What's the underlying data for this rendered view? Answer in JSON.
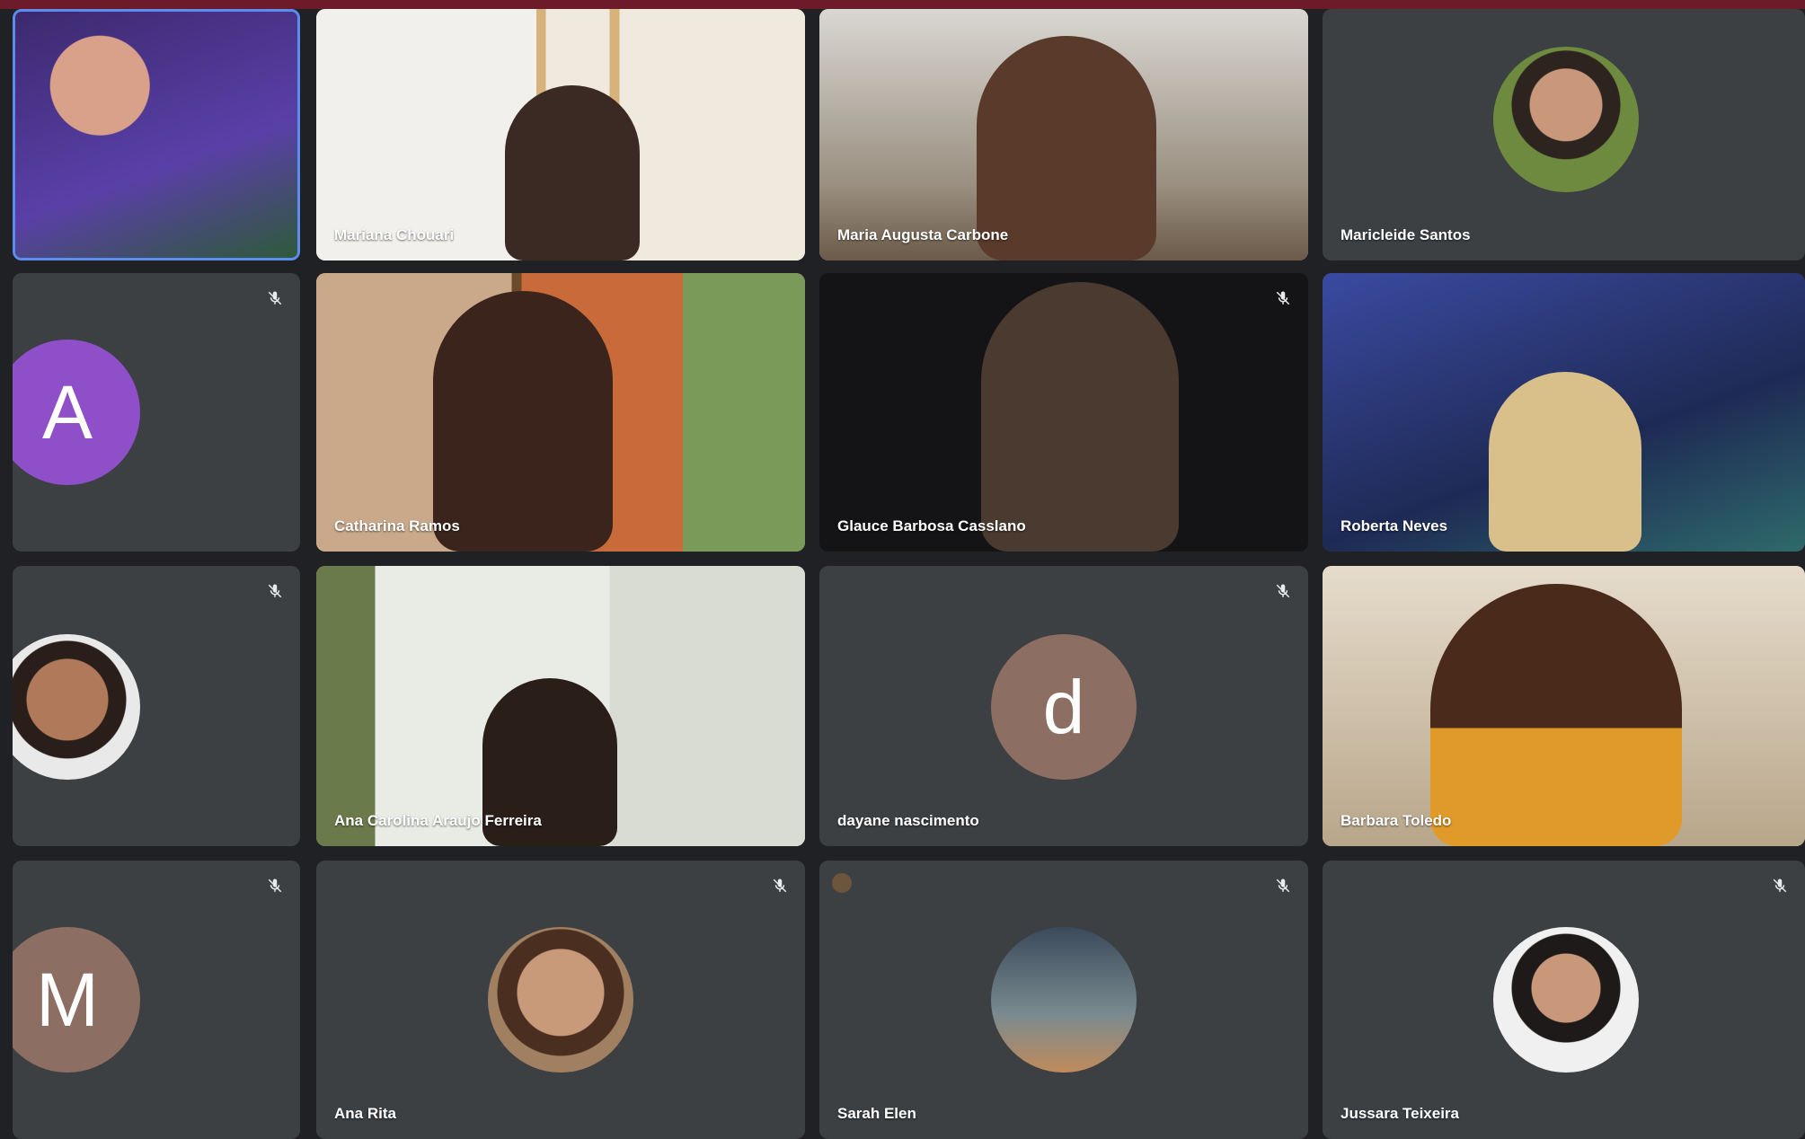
{
  "meeting": {
    "tiles": [
      {
        "name": ""
      },
      {
        "name": "Mariana Chouari"
      },
      {
        "name": "Maria Augusta Carbone"
      },
      {
        "name": "Maricleide Santos"
      },
      {
        "name": "",
        "initial": "A"
      },
      {
        "name": "Catharina Ramos"
      },
      {
        "name": "Glauce Barbosa Casslano"
      },
      {
        "name": "Roberta Neves"
      },
      {
        "name": ""
      },
      {
        "name": "Ana Carolina Araujo Ferreira"
      },
      {
        "name": "dayane nascimento",
        "initial": "d"
      },
      {
        "name": "Barbara Toledo"
      },
      {
        "name": "",
        "initial": "M"
      },
      {
        "name": "Ana Rita"
      },
      {
        "name": "Sarah Elen"
      },
      {
        "name": "Jussara Teixeira"
      }
    ]
  },
  "colors": {
    "top_bar": "#6d1a2a",
    "tile_bg": "#3c4043",
    "avatar_A": "#8e4fc9",
    "avatar_d": "#8d6e63",
    "avatar_M": "#8d6e63"
  },
  "icons": {
    "muted": "mic-off-icon"
  }
}
